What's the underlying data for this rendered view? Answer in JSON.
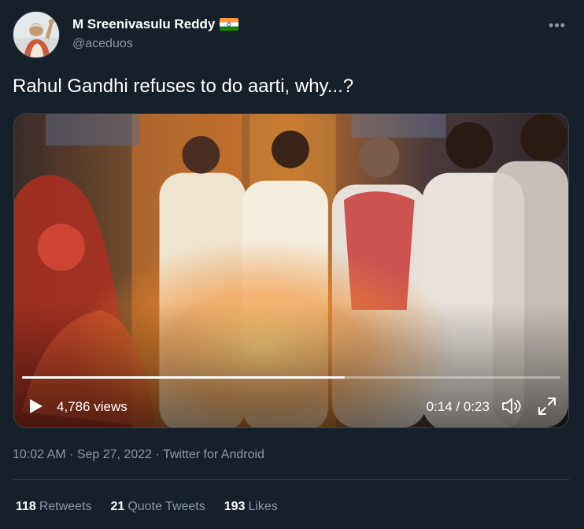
{
  "author": {
    "name": "M Sreenivasulu Reddy",
    "handle": "@aceduos",
    "flag_icon": "india-flag-icon"
  },
  "tweet": {
    "text": "Rahul Gandhi refuses to do aarti, why...?"
  },
  "video": {
    "views": "4,786 views",
    "time": "0:14 / 0:23",
    "progress": 0.6,
    "icons": [
      "play-icon",
      "volume-icon",
      "fullscreen-icon"
    ]
  },
  "meta": {
    "time": "10:02 AM",
    "separator1": " · ",
    "date": "Sep 27, 2022",
    "separator2": " · ",
    "source": "Twitter for Android"
  },
  "stats": {
    "retweets_count": "118",
    "retweets_label": "Retweets",
    "quotes_count": "21",
    "quotes_label": "Quote Tweets",
    "likes_count": "193",
    "likes_label": "Likes"
  },
  "colors": {
    "background": "#15202b",
    "secondary_text": "#8b98a5",
    "divider": "#38444d"
  }
}
